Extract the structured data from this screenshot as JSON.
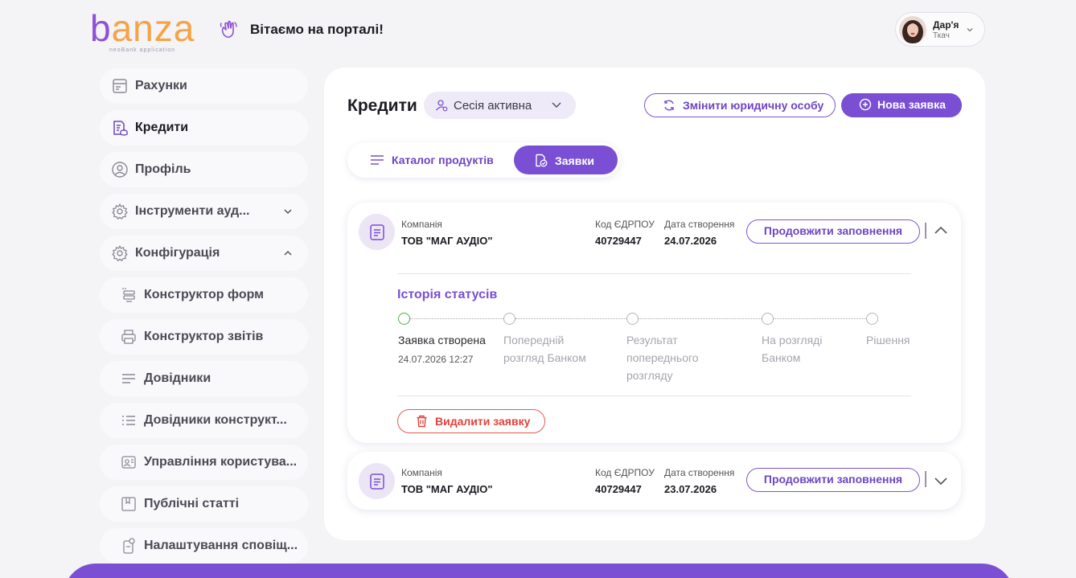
{
  "brand": {
    "logo_text": "banza",
    "logo_sub": "neoBank application",
    "colors": {
      "accent": "#7a4fd3",
      "logo_orange": "#f5a347",
      "logo_purple": "#8c52d6",
      "danger": "#e0433c",
      "success": "#4caf50"
    }
  },
  "header": {
    "welcome": "Вітаємо на порталі!",
    "wave_icon": "waving-hand-icon",
    "user": {
      "first_name": "Дар'я",
      "last_name": "Ткач"
    }
  },
  "sidebar": {
    "items": [
      {
        "label": "Рахунки",
        "icon": "accounts-icon"
      },
      {
        "label": "Кредити",
        "icon": "credits-icon",
        "active": true
      },
      {
        "label": "Профіль",
        "icon": "profile-icon"
      },
      {
        "label": "Інструменти ауд...",
        "icon": "gear-icon",
        "expandable": "collapsed"
      },
      {
        "label": "Конфігурація",
        "icon": "gear-icon",
        "expandable": "expanded"
      },
      {
        "label": "Конструктор форм",
        "icon": "form-builder-icon",
        "sub": true
      },
      {
        "label": "Конструктор звітів",
        "icon": "report-builder-icon",
        "sub": true
      },
      {
        "label": "Довідники",
        "icon": "list-icon",
        "sub": true
      },
      {
        "label": "Довідники конструкт...",
        "icon": "list-bullets-icon",
        "sub": true
      },
      {
        "label": "Управління користува...",
        "icon": "users-icon",
        "sub": true
      },
      {
        "label": "Публічні статті",
        "icon": "article-icon",
        "sub": true
      },
      {
        "label": "Налаштування сповіщ...",
        "icon": "notification-settings-icon",
        "sub": true
      }
    ]
  },
  "main": {
    "title": "Кредити",
    "session": {
      "label": "Сесія активна"
    },
    "change_entity_label": "Змінити юридичну особу",
    "new_application_label": "Нова заявка",
    "tabs": [
      {
        "label": "Каталог продуктів",
        "active": false
      },
      {
        "label": "Заявки",
        "active": true
      }
    ],
    "field_labels": {
      "company": "Компанія",
      "edrpou": "Код ЄДРПОУ",
      "created": "Дата створення"
    },
    "applications": [
      {
        "company": "ТОВ \"МАГ АУДІО\"",
        "edrpou": "40729447",
        "created": "24.07.2026",
        "continue_label": "Продовжити заповнення",
        "expanded": true,
        "history_title": "Історія статусів",
        "statuses": [
          {
            "label": "Заявка створена",
            "date": "24.07.2026 12:27",
            "done": true
          },
          {
            "label": "Попередній розгляд Банком",
            "done": false
          },
          {
            "label": "Результат попереднього розгляду",
            "done": false
          },
          {
            "label": "На розгляді Банком",
            "done": false
          },
          {
            "label": "Рішення",
            "done": false
          }
        ],
        "delete_label": "Видалити заявку"
      },
      {
        "company": "ТОВ \"МАГ АУДІО\"",
        "edrpou": "40729447",
        "created": "23.07.2026",
        "continue_label": "Продовжити заповнення",
        "expanded": false
      }
    ]
  }
}
